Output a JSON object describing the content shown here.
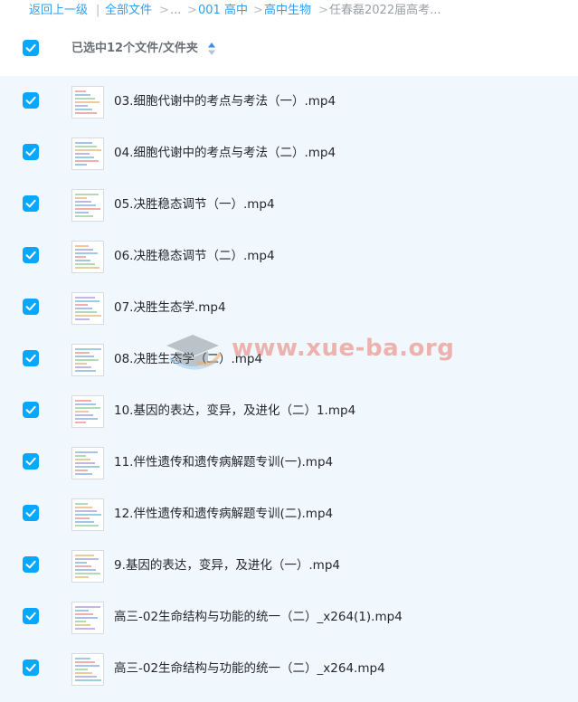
{
  "breadcrumb": {
    "back": "返回上一级",
    "sep1": "|",
    "all_files": "全部文件",
    "sep2": ">",
    "ellipsis": "...",
    "sep3": ">",
    "level1": "001 高中",
    "sep4": ">",
    "level2": "高中生物",
    "sep5": ">",
    "current": "任春磊2022届高考..."
  },
  "header": {
    "selected_text": "已选中12个文件/文件夹",
    "all_checked": true
  },
  "files": [
    {
      "name": "03.细胞代谢中的考点与考法（一）.mp4",
      "checked": true
    },
    {
      "name": "04.细胞代谢中的考点与考法（二）.mp4",
      "checked": true
    },
    {
      "name": "05.决胜稳态调节（一）.mp4",
      "checked": true
    },
    {
      "name": "06.决胜稳态调节（二）.mp4",
      "checked": true
    },
    {
      "name": "07.决胜生态学.mp4",
      "checked": true
    },
    {
      "name": "08.决胜生态学（二）.mp4",
      "checked": true
    },
    {
      "name": "10.基因的表达，变异，及进化（二）1.mp4",
      "checked": true
    },
    {
      "name": "11.伴性遗传和遗传病解题专训(一).mp4",
      "checked": true
    },
    {
      "name": "12.伴性遗传和遗传病解题专训(二).mp4",
      "checked": true
    },
    {
      "name": "9.基因的表达，变异，及进化（一）.mp4",
      "checked": true
    },
    {
      "name": "高三-02生命结构与功能的统一（二）_x264(1).mp4",
      "checked": true
    },
    {
      "name": "高三-02生命结构与功能的统一（二）_x264.mp4",
      "checked": true
    }
  ],
  "watermark": {
    "text": "www.xue-ba.org",
    "icon": "graduation-cap-icon"
  },
  "colors": {
    "accent": "#06a7ff",
    "link": "#2f9ff0",
    "list_bg": "#f0f7fd"
  }
}
